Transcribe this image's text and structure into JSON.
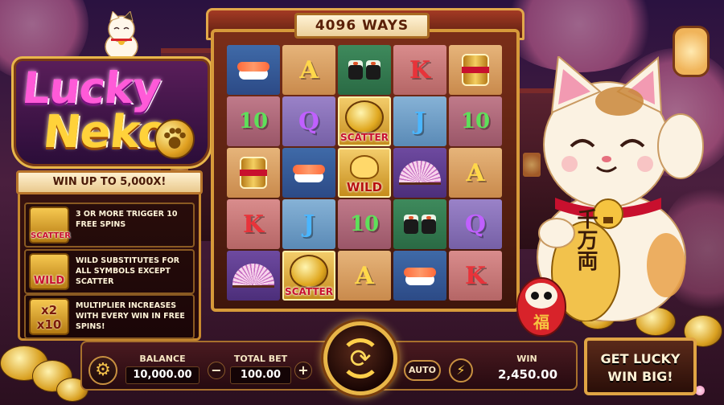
{
  "logo": {
    "word1": "Lucky",
    "word2": "Neko"
  },
  "win_banner": "WIN UP TO 5,000X!",
  "info": [
    {
      "icon_name": "scatter-coin-icon",
      "tag": "SCATTER",
      "text": "3 OR MORE TRIGGER 10 FREE SPINS"
    },
    {
      "icon_name": "wild-cat-icon",
      "tag": "WILD",
      "text": "WILD SUBSTITUTES FOR ALL SYMBOLS EXCEPT SCATTER"
    },
    {
      "icon_name": "multiplier-icon",
      "tag_line1": "x2",
      "tag_line2": "x10",
      "text": "MULTIPLIER INCREASES WITH EVERY WIN IN FREE SPINS!"
    }
  ],
  "ways": "4096 WAYS",
  "grid": [
    [
      {
        "sym": "sushi",
        "bg": "blue"
      },
      {
        "sym": "A",
        "bg": "tan"
      },
      {
        "sym": "roll",
        "bg": "green"
      },
      {
        "sym": "K",
        "bg": "pink"
      },
      {
        "sym": "drum",
        "bg": "tan"
      }
    ],
    [
      {
        "sym": "10",
        "bg": "rose"
      },
      {
        "sym": "Q",
        "bg": "lilac"
      },
      {
        "sym": "scatter",
        "bg": "gold",
        "label": "SCATTER"
      },
      {
        "sym": "J",
        "bg": "ltblue"
      },
      {
        "sym": "10",
        "bg": "rose"
      }
    ],
    [
      {
        "sym": "drum",
        "bg": "tan"
      },
      {
        "sym": "sushi",
        "bg": "blue"
      },
      {
        "sym": "wild",
        "bg": "gold",
        "label": "WILD"
      },
      {
        "sym": "fan",
        "bg": "purple"
      },
      {
        "sym": "A",
        "bg": "tan"
      }
    ],
    [
      {
        "sym": "K",
        "bg": "pink"
      },
      {
        "sym": "J",
        "bg": "ltblue"
      },
      {
        "sym": "10",
        "bg": "rose"
      },
      {
        "sym": "roll",
        "bg": "green"
      },
      {
        "sym": "Q",
        "bg": "lilac"
      }
    ],
    [
      {
        "sym": "fan",
        "bg": "purple"
      },
      {
        "sym": "scatter",
        "bg": "gold",
        "label": "SCATTER"
      },
      {
        "sym": "A",
        "bg": "tan"
      },
      {
        "sym": "sushi",
        "bg": "blue"
      },
      {
        "sym": "K",
        "bg": "pink"
      }
    ]
  ],
  "coin_text": "千万両",
  "daruma_text": "福",
  "bottom": {
    "balance_label": "BALANCE",
    "balance_value": "10,000.00",
    "bet_label": "TOTAL BET",
    "bet_value": "100.00",
    "minus": "−",
    "plus": "+",
    "auto": "AUTO",
    "win_label": "WIN",
    "win_value": "2,450.00"
  },
  "cta": {
    "line1": "GET LUCKY",
    "line2": "WIN BIG!"
  },
  "colors": {
    "gold": "#e8b648",
    "magenta": "#ff5ad8",
    "scatter_red": "#c8102e"
  }
}
